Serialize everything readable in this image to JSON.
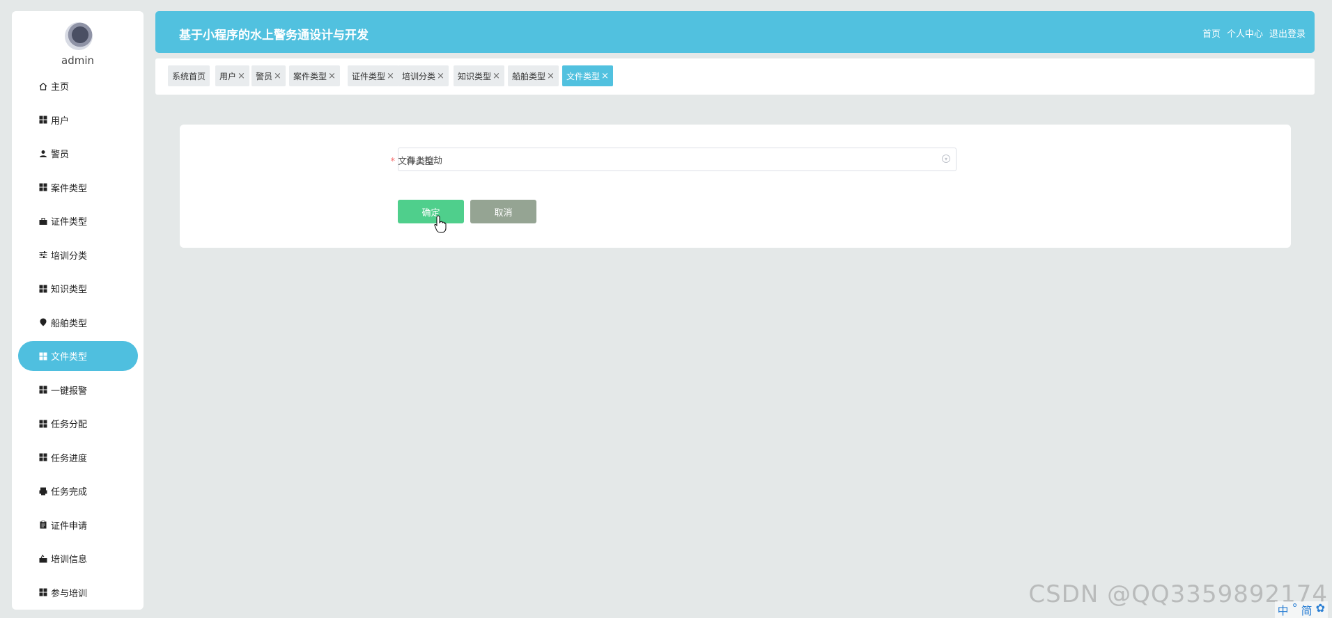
{
  "sidebar": {
    "username": "admin",
    "items": [
      {
        "label": "主页",
        "icon": "home-icon",
        "active": false
      },
      {
        "label": "用户",
        "icon": "grid-icon",
        "active": false
      },
      {
        "label": "警员",
        "icon": "person-icon",
        "active": false
      },
      {
        "label": "案件类型",
        "icon": "grid-icon",
        "active": false
      },
      {
        "label": "证件类型",
        "icon": "briefcase-icon",
        "active": false
      },
      {
        "label": "培训分类",
        "icon": "sliders-icon",
        "active": false
      },
      {
        "label": "知识类型",
        "icon": "grid-icon",
        "active": false
      },
      {
        "label": "船舶类型",
        "icon": "pin-icon",
        "active": false
      },
      {
        "label": "文件类型",
        "icon": "grid-icon",
        "active": true
      },
      {
        "label": "一键报警",
        "icon": "grid-icon",
        "active": false
      },
      {
        "label": "任务分配",
        "icon": "grid-icon",
        "active": false
      },
      {
        "label": "任务进度",
        "icon": "grid-icon",
        "active": false
      },
      {
        "label": "任务完成",
        "icon": "printer-icon",
        "active": false
      },
      {
        "label": "证件申请",
        "icon": "clipboard-icon",
        "active": false
      },
      {
        "label": "培训信息",
        "icon": "case-icon",
        "active": false
      },
      {
        "label": "参与培训",
        "icon": "grid-icon",
        "active": false
      }
    ]
  },
  "header": {
    "title": "基于小程序的水上警务通设计与开发",
    "links": [
      "首页",
      "个人中心",
      "退出登录"
    ]
  },
  "tabs": [
    {
      "label": "系统首页",
      "closable": false,
      "active": false
    },
    {
      "label": "用户",
      "closable": true,
      "active": false
    },
    {
      "label": "警员",
      "closable": true,
      "active": false
    },
    {
      "label": "案件类型",
      "closable": true,
      "active": false
    },
    {
      "label": "证件类型",
      "closable": true,
      "active": false
    },
    {
      "label": "培训分类",
      "closable": true,
      "active": false
    },
    {
      "label": "知识类型",
      "closable": true,
      "active": false
    },
    {
      "label": "船舶类型",
      "closable": true,
      "active": false
    },
    {
      "label": "文件类型",
      "closable": true,
      "active": true
    }
  ],
  "form": {
    "required_mark": "*",
    "field_label": "文件类型",
    "field_value": "海上抢劫",
    "confirm_label": "确定",
    "cancel_label": "取消"
  },
  "watermark": "CSDN @QQ3359892174",
  "ime": [
    "中",
    "°",
    "简",
    "✿"
  ],
  "colors": {
    "accent": "#51c1df",
    "confirm": "#4fcf8c",
    "cancel": "#95a493",
    "background": "#e4e8e8"
  }
}
